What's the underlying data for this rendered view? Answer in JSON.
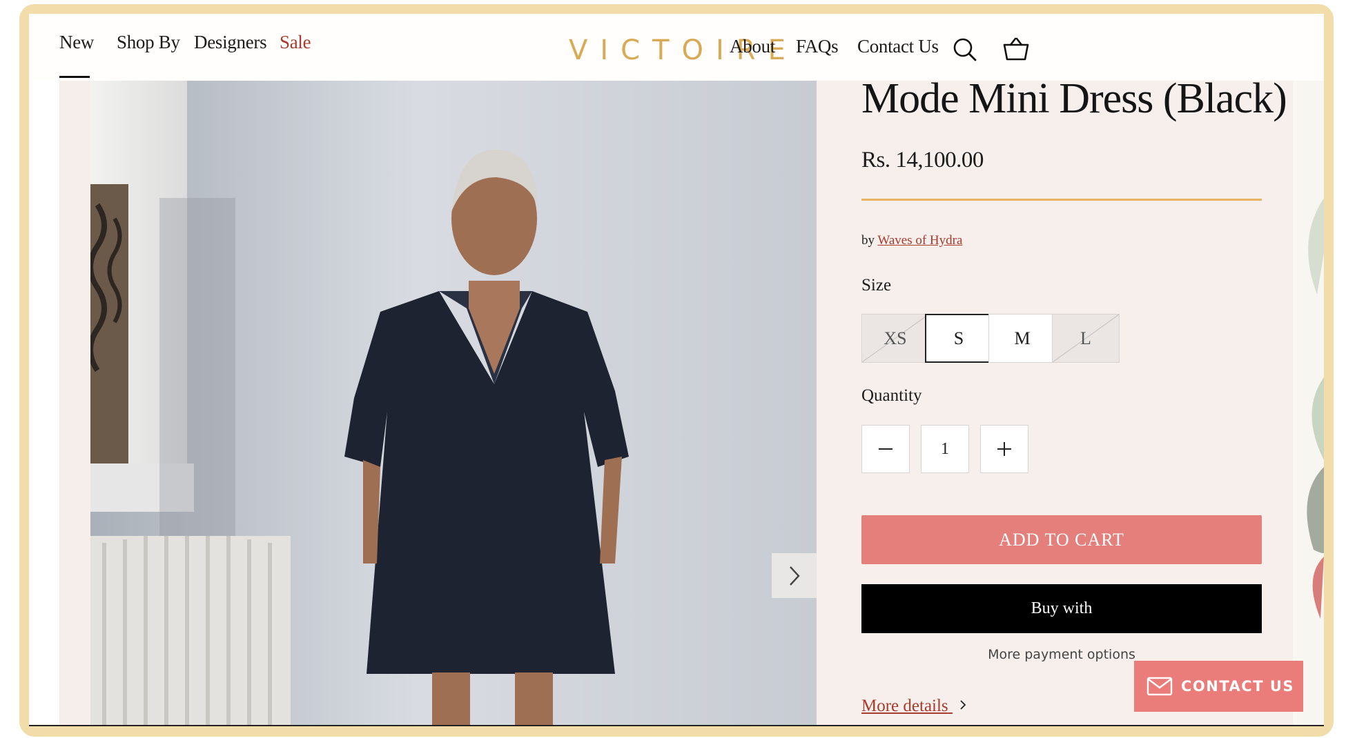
{
  "header": {
    "nav_left": [
      "New",
      "Shop By",
      "Designers",
      "Sale"
    ],
    "logo": "VICTOIRE",
    "nav_right": [
      "About",
      "FAQs",
      "Contact Us"
    ],
    "icons": [
      "search-icon",
      "cart-icon"
    ]
  },
  "product": {
    "title": "Mode Mini Dress (Black)",
    "price": "Rs. 14,100.00",
    "by_prefix": "by",
    "designer": "Waves of Hydra",
    "size_label": "Size",
    "sizes": [
      {
        "label": "XS",
        "available": false,
        "selected": false
      },
      {
        "label": "S",
        "available": true,
        "selected": true
      },
      {
        "label": "M",
        "available": true,
        "selected": false
      },
      {
        "label": "L",
        "available": false,
        "selected": false
      }
    ],
    "quantity_label": "Quantity",
    "quantity": "1",
    "minus_label": "−",
    "plus_label": "+",
    "add_to_cart": "ADD TO CART",
    "buy_with": "Buy with",
    "more_payment": "More payment options",
    "more_details": "More details"
  },
  "contact_widget": {
    "label": "CONTACT US",
    "icon": "mail-icon"
  },
  "colors": {
    "accent_gold": "#d8aa55",
    "sale_red": "#a83a2e",
    "add_to_cart": "#e47f7b",
    "panel_bg": "#f6efec"
  }
}
